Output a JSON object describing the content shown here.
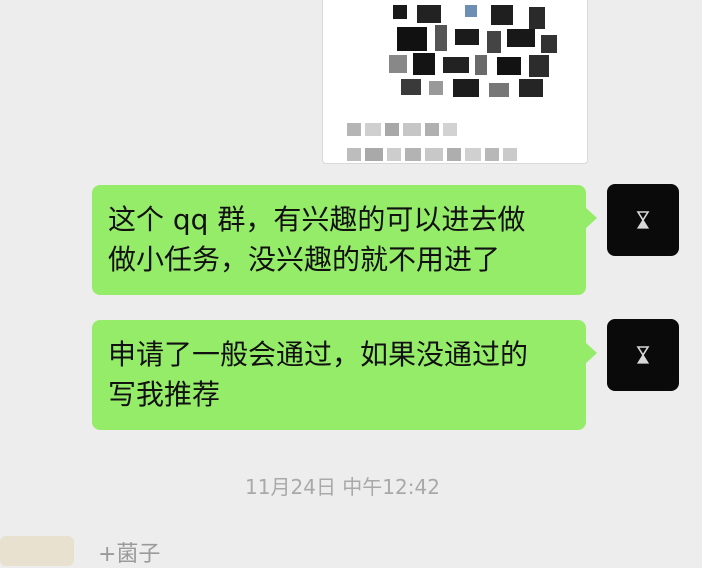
{
  "messages": [
    {
      "lines": [
        "这个 qq 群，有兴趣的可以进去做",
        "做小任务，没兴趣的就不用进了"
      ]
    },
    {
      "lines": [
        "申请了一般会通过，如果没通过的",
        "写我推荐"
      ]
    }
  ],
  "timestamp": "11月24日 中午12:42",
  "next_sender": {
    "name": "+菌子"
  },
  "colors": {
    "background": "#ededed",
    "bubble": "#95ec69",
    "avatar": "#0a0a0a",
    "timestamp": "#a9a9a9"
  },
  "icons": {
    "avatar": "hourglass-icon"
  }
}
